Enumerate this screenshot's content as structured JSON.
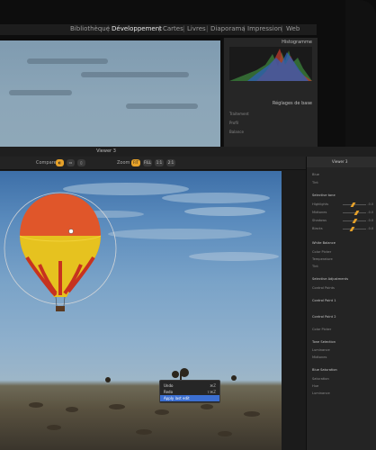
{
  "back_app": {
    "menu": [
      "Bibliothèque",
      "Développement",
      "Cartes",
      "Livres",
      "Diaporama",
      "Impression",
      "Web"
    ],
    "active_menu": "Développement",
    "histogram_title": "Histogramme",
    "basic_panel_title": "Réglages de base",
    "rows": [
      "Traitement",
      "Profil",
      "Balance"
    ]
  },
  "window": {
    "title": "Viewer 3",
    "toolbar": {
      "compare_label": "Compare",
      "zoom_label": "Zoom",
      "zoom_buttons": [
        "FIT",
        "FILL",
        "1:1",
        "2:1"
      ]
    }
  },
  "sidebar": {
    "title": "Viewer 3",
    "rows": [
      "Blue",
      "Tint",
      "Selective tone",
      "Highlights",
      "Midtones",
      "Shadows",
      "Blacks",
      "White Balance",
      "Color Picker",
      "Temperature",
      "Tint",
      "Selective Adjustments",
      "Control Points",
      "Control Point 1",
      "Control Point 2",
      "Color Picker",
      "Tone Selection",
      "Luminance",
      "Midtones",
      "Blue Saturation",
      "Saturation",
      "Hue",
      "Luminance"
    ],
    "values": [
      "-0.0",
      "-0.0",
      "-0.0",
      "-0.0"
    ]
  },
  "context_menu": {
    "items": [
      {
        "label": "Undo",
        "shortcut": "⌘Z"
      },
      {
        "label": "Redo",
        "shortcut": "⇧⌘Z"
      },
      {
        "label": "Apply last edit",
        "shortcut": ""
      }
    ]
  },
  "colors": {
    "accent": "#e7a22a",
    "selection": "#3c6fd1"
  }
}
